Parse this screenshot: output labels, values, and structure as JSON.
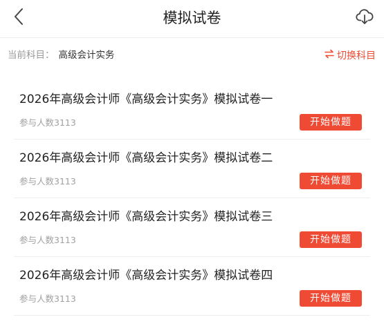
{
  "header": {
    "title": "模拟试卷",
    "back_icon": "chevron-left-icon",
    "download_icon": "cloud-download-icon"
  },
  "subject": {
    "label": "当前科目：",
    "value": "高级会计实务",
    "switch_label": "切换科目",
    "switch_icon": "swap-arrows-icon"
  },
  "colors": {
    "accent": "#ef4a33",
    "title_text": "#222222",
    "secondary_text": "#999999",
    "divider": "#ededed"
  },
  "papers": [
    {
      "title": "2026年高级会计师《高级会计实务》模拟试卷一",
      "participants": "参与人数3113",
      "action": "开始做题"
    },
    {
      "title": "2026年高级会计师《高级会计实务》模拟试卷二",
      "participants": "参与人数3113",
      "action": "开始做题"
    },
    {
      "title": "2026年高级会计师《高级会计实务》模拟试卷三",
      "participants": "参与人数3113",
      "action": "开始做题"
    },
    {
      "title": "2026年高级会计师《高级会计实务》模拟试卷四",
      "participants": "参与人数3113",
      "action": "开始做题"
    }
  ]
}
